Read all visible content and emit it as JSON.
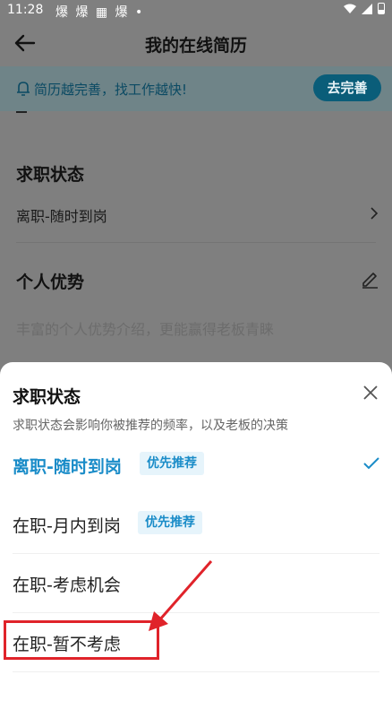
{
  "status_bar": {
    "time": "11:28",
    "notif_icons": "爆 爆 ▦ 爆 •"
  },
  "header": {
    "title": "我的在线简历"
  },
  "banner": {
    "text": "简历越完善，找工作越快!",
    "button": "去完善"
  },
  "background": {
    "job_status": {
      "title": "求职状态",
      "value": "离职-随时到岗"
    },
    "advantage": {
      "title": "个人优势",
      "placeholder": "丰富的个人优势介绍，更能赢得老板青睐"
    }
  },
  "sheet": {
    "title": "求职状态",
    "desc": "求职状态会影响你被推荐的频率，以及老板的决策",
    "options": [
      {
        "label": "离职-随时到岗",
        "badge": "优先推荐",
        "selected": true
      },
      {
        "label": "在职-月内到岗",
        "badge": "优先推荐",
        "selected": false
      },
      {
        "label": "在职-考虑机会",
        "badge": "",
        "selected": false
      },
      {
        "label": "在职-暂不考虑",
        "badge": "",
        "selected": false
      }
    ]
  },
  "colors": {
    "accent": "#1a8cc8",
    "annotation": "#e0232a",
    "overlay": "#7f7f7f"
  }
}
